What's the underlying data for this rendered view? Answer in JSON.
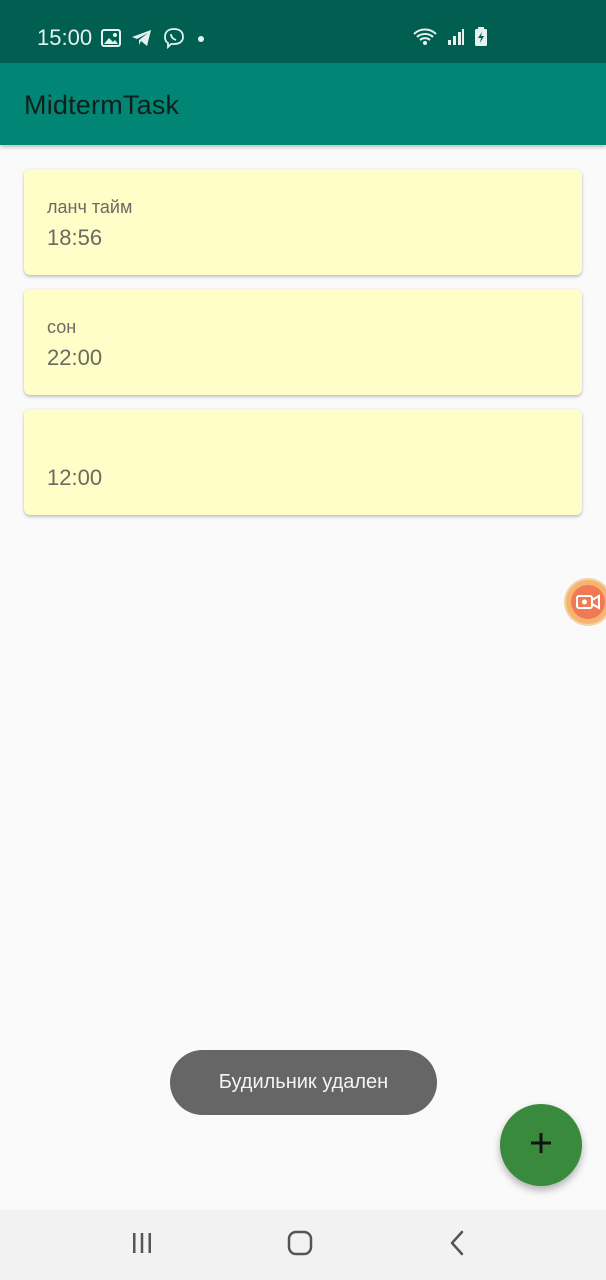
{
  "status_bar": {
    "time": "15:00",
    "left_icons": [
      "image-icon",
      "telegram-icon",
      "viber-icon",
      "dot-icon"
    ],
    "right_icons": [
      "wifi-icon",
      "signal-icon",
      "battery-charging-icon"
    ]
  },
  "app_bar": {
    "title": "MidtermTask"
  },
  "alarms": [
    {
      "name": "ланч тайм",
      "time": "18:56"
    },
    {
      "name": "сон",
      "time": "22:00"
    },
    {
      "name": "",
      "time": "12:00"
    }
  ],
  "toast": {
    "message": "Будильник удален"
  },
  "fab": {
    "icon": "plus-icon"
  },
  "nav_bar": {
    "icons": [
      "recent-apps-icon",
      "home-icon",
      "back-icon"
    ]
  },
  "colors": {
    "status_bar": "#015f52",
    "app_bar": "#018675",
    "card": "#fffdc8",
    "fab": "#3a8a3e",
    "toast": "#666666"
  }
}
